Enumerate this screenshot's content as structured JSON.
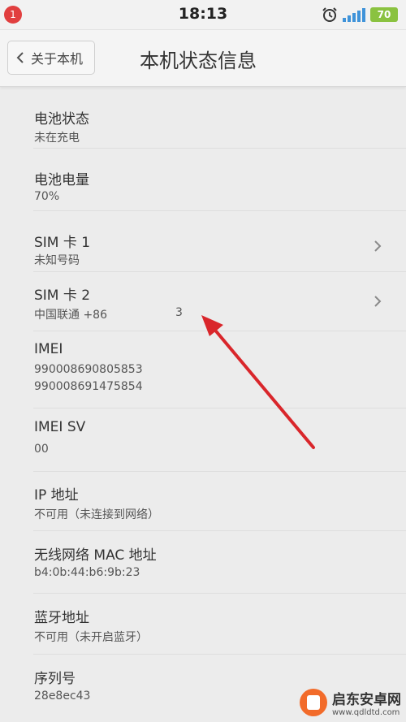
{
  "status_bar": {
    "notification_count": "1",
    "time": "18:13",
    "battery": "70",
    "accent_color": "#8ac240"
  },
  "header": {
    "back_label": "关于本机",
    "title": "本机状态信息"
  },
  "items": [
    {
      "label": "电池状态",
      "value": "未在充电"
    },
    {
      "label": "电池电量",
      "value": "70%"
    },
    {
      "label": "SIM 卡 1",
      "value": "未知号码"
    },
    {
      "label": "SIM 卡 2",
      "value": "中国联通 +86",
      "value_suffix": "3"
    },
    {
      "label": "IMEI",
      "value": "990008690805853",
      "value2": "990008691475854"
    },
    {
      "label": "IMEI SV",
      "value": "00"
    },
    {
      "label": "IP 地址",
      "value": "不可用（未连接到网络）"
    },
    {
      "label": "无线网络 MAC 地址",
      "value": "b4:0b:44:b6:9b:23"
    },
    {
      "label": "蓝牙地址",
      "value": "不可用（未开启蓝牙）"
    },
    {
      "label": "序列号",
      "value": "28e8ec43"
    }
  ],
  "watermark": {
    "name": "启东安卓网",
    "url": "www.qdldtd.com"
  },
  "annotation_color": "#d9262b"
}
